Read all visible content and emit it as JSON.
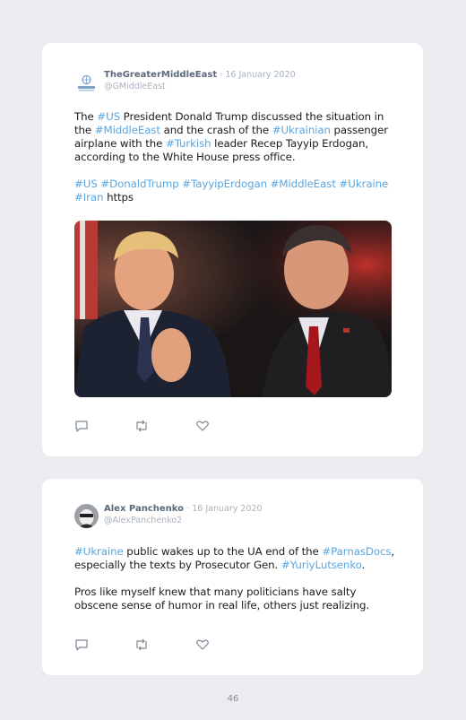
{
  "tweets": [
    {
      "author": "TheGreaterMiddleEast",
      "date": "· 16 January 2020",
      "handle": "@GMiddleEast",
      "avatar_icon": "globe-logo-icon",
      "text_parts": [
        {
          "t": "The ",
          "tag": false
        },
        {
          "t": "#US",
          "tag": true
        },
        {
          "t": " President Donald Trump discussed the situation in the ",
          "tag": false
        },
        {
          "t": "#MiddleEast",
          "tag": true
        },
        {
          "t": " and the crash of the ",
          "tag": false
        },
        {
          "t": "#Ukrainian",
          "tag": true
        },
        {
          "t": " passenger airplane with the ",
          "tag": false
        },
        {
          "t": "#Turkish",
          "tag": true
        },
        {
          "t": " leader Recep Tayyip Erdogan, according to the White House press office.",
          "tag": false
        }
      ],
      "hashtag_parts": [
        {
          "t": "#US",
          "tag": true
        },
        {
          "t": " ",
          "tag": false
        },
        {
          "t": "#DonaldTrump",
          "tag": true
        },
        {
          "t": " ",
          "tag": false
        },
        {
          "t": "#TayyipErdogan",
          "tag": true
        },
        {
          "t": " ",
          "tag": false
        },
        {
          "t": "#MiddleEast",
          "tag": true
        },
        {
          "t": " ",
          "tag": false
        },
        {
          "t": "#Ukraine",
          "tag": true
        },
        {
          "t": " ",
          "tag": false
        },
        {
          "t": "#Iran",
          "tag": true
        },
        {
          "t": " https",
          "tag": false
        }
      ],
      "photo": "photo of two politicians"
    },
    {
      "author": "Alex Panchenko",
      "date": "· 16 January 2020",
      "handle": "@AlexPanchenko2",
      "avatar_icon": "user-avatar-icon",
      "text_parts": [
        {
          "t": "#Ukraine",
          "tag": true
        },
        {
          "t": " public wakes up to the UA end of the ",
          "tag": false
        },
        {
          "t": "#ParnasDocs",
          "tag": true
        },
        {
          "t": ", especially the texts by Prosecutor Gen. ",
          "tag": false
        },
        {
          "t": "#YuriyLutsenko",
          "tag": true
        },
        {
          "t": ".",
          "tag": false
        }
      ],
      "second_paragraph": "Pros like myself knew that many politicians have salty obscene sense of humor in real life, others just realizing."
    }
  ],
  "actions": [
    "reply-icon",
    "retweet-icon",
    "like-icon"
  ],
  "page_number": "46",
  "colors": {
    "hashtag": "#5aa6e0",
    "background": "#ebebf0",
    "card": "#ffffff"
  }
}
